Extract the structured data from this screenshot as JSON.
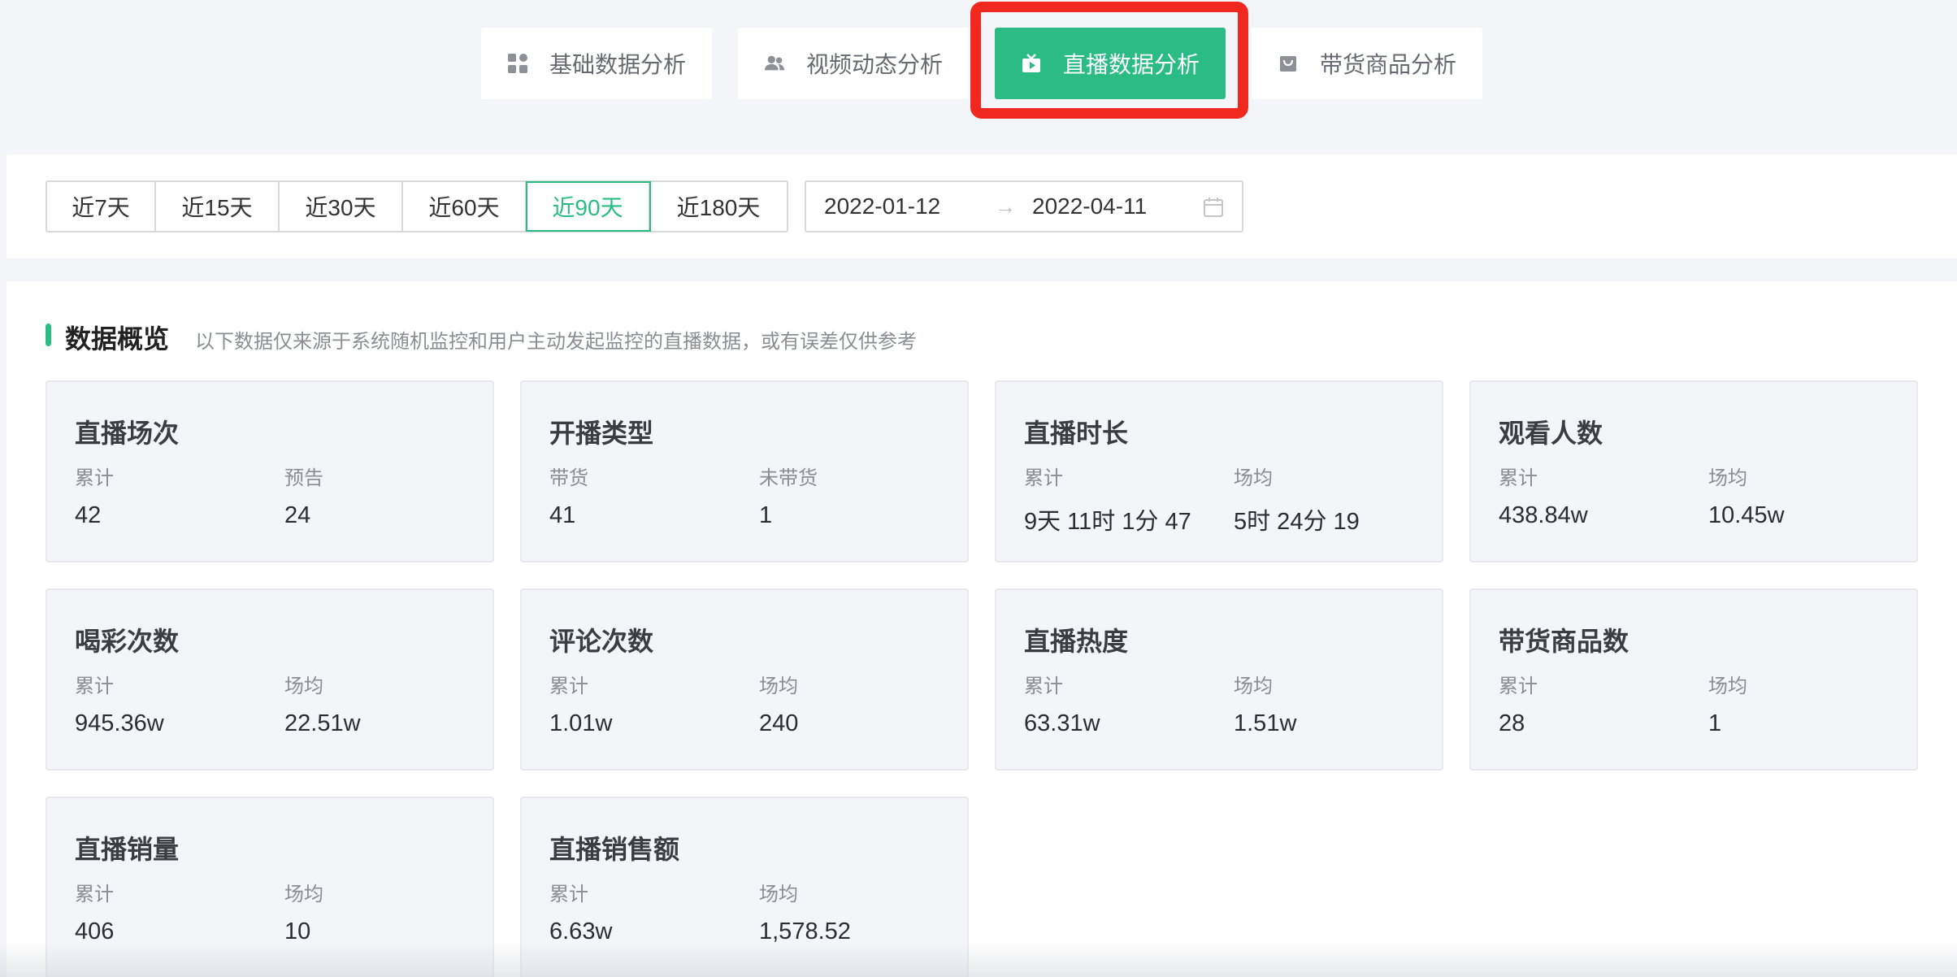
{
  "tabs": [
    {
      "label": "基础数据分析",
      "icon": "grid-icon"
    },
    {
      "label": "视频动态分析",
      "icon": "users-icon"
    },
    {
      "label": "直播数据分析",
      "icon": "live-tv-icon"
    },
    {
      "label": "带货商品分析",
      "icon": "shopping-bag-icon"
    }
  ],
  "active_tab": "直播数据分析",
  "colors": {
    "accent": "#2bbc85",
    "highlight": "#f0281e"
  },
  "filter": {
    "ranges": [
      "近7天",
      "近15天",
      "近30天",
      "近60天",
      "近90天",
      "近180天"
    ],
    "selected_range": "近90天",
    "start_date": "2022-01-12",
    "arrow": "→",
    "end_date": "2022-04-11"
  },
  "overview": {
    "title": "数据概览",
    "note": "以下数据仅来源于系统随机监控和用户主动发起监控的直播数据，或有误差仅供参考",
    "cards": [
      {
        "title": "直播场次",
        "label_a": "累计",
        "value_a": "42",
        "label_b": "预告",
        "value_b": "24"
      },
      {
        "title": "开播类型",
        "label_a": "带货",
        "value_a": "41",
        "label_b": "未带货",
        "value_b": "1"
      },
      {
        "title": "直播时长",
        "label_a": "累计",
        "value_a": "9天 11时 1分 47",
        "label_b": "场均",
        "value_b": "5时 24分 19"
      },
      {
        "title": "观看人数",
        "label_a": "累计",
        "value_a": "438.84w",
        "label_b": "场均",
        "value_b": "10.45w"
      },
      {
        "title": "喝彩次数",
        "label_a": "累计",
        "value_a": "945.36w",
        "label_b": "场均",
        "value_b": "22.51w"
      },
      {
        "title": "评论次数",
        "label_a": "累计",
        "value_a": "1.01w",
        "label_b": "场均",
        "value_b": "240"
      },
      {
        "title": "直播热度",
        "label_a": "累计",
        "value_a": "63.31w",
        "label_b": "场均",
        "value_b": "1.51w"
      },
      {
        "title": "带货商品数",
        "label_a": "累计",
        "value_a": "28",
        "label_b": "场均",
        "value_b": "1"
      },
      {
        "title": "直播销量",
        "label_a": "累计",
        "value_a": "406",
        "label_b": "场均",
        "value_b": "10"
      },
      {
        "title": "直播销售额",
        "label_a": "累计",
        "value_a": "6.63w",
        "label_b": "场均",
        "value_b": "1,578.52"
      }
    ]
  }
}
